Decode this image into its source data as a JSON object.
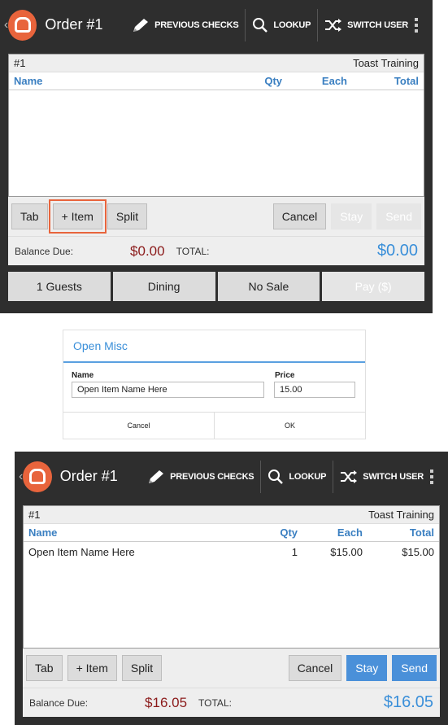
{
  "screen1": {
    "header": {
      "title": "Order #1",
      "previous_checks": "PREVIOUS CHECKS",
      "lookup": "LOOKUP",
      "switch_user": "SWITCH USER"
    },
    "ticket": {
      "number": "#1",
      "location": "Toast Training",
      "columns": {
        "name": "Name",
        "qty": "Qty",
        "each": "Each",
        "total": "Total"
      }
    },
    "actions": {
      "tab": "Tab",
      "add_item": "+ Item",
      "split": "Split",
      "cancel": "Cancel",
      "stay": "Stay",
      "send": "Send"
    },
    "balance": {
      "label": "Balance Due:",
      "due": "$0.00",
      "total_label": "TOTAL:",
      "total": "$0.00"
    },
    "bottom": {
      "guests": "1 Guests",
      "dining": "Dining",
      "no_sale": "No Sale",
      "pay": "Pay ($)"
    }
  },
  "dialog": {
    "title": "Open Misc",
    "name_label": "Name",
    "price_label": "Price",
    "name_value": "Open Item Name Here",
    "price_value": "15.00",
    "cancel": "Cancel",
    "ok": "OK"
  },
  "screen2": {
    "header": {
      "title": "Order #1",
      "previous_checks": "PREVIOUS CHECKS",
      "lookup": "LOOKUP",
      "switch_user": "SWITCH USER"
    },
    "ticket": {
      "number": "#1",
      "location": "Toast Training",
      "columns": {
        "name": "Name",
        "qty": "Qty",
        "each": "Each",
        "total": "Total"
      },
      "items": [
        {
          "name": "Open Item Name Here",
          "qty": "1",
          "each": "$15.00",
          "total": "$15.00"
        }
      ]
    },
    "actions": {
      "tab": "Tab",
      "add_item": "+ Item",
      "split": "Split",
      "cancel": "Cancel",
      "stay": "Stay",
      "send": "Send"
    },
    "balance": {
      "label": "Balance Due:",
      "due": "$16.05",
      "total_label": "TOTAL:",
      "total": "$16.05"
    }
  },
  "colors": {
    "accent": "#e8643c",
    "blue": "#4a90d9",
    "due_red": "#8b1a1a"
  }
}
